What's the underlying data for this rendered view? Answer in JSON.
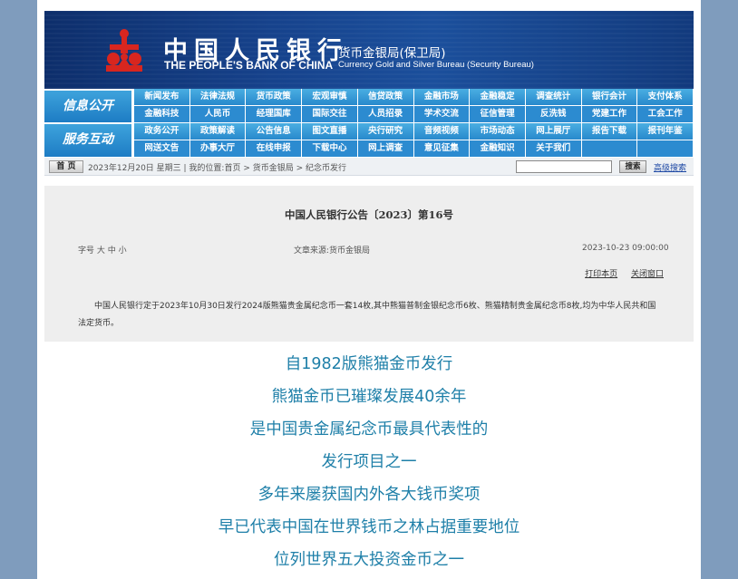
{
  "header": {
    "cn_name": "中国人民银行",
    "en_name": "THE PEOPLE'S BANK OF CHINA",
    "bureau_cn": "货币金银局(保卫局)",
    "bureau_en": "Currency Gold and Silver Bureau (Security Bureau)",
    "logo_icon": "pboc-logo-icon",
    "colors": {
      "banner": "#16428c",
      "logo": "#d8261f",
      "nav": "#2889cc"
    }
  },
  "nav": {
    "label_1": "信息公开",
    "label_2": "服务互动",
    "row1": [
      "新闻发布",
      "法律法规",
      "货币政策",
      "宏观审慎",
      "信贷政策",
      "金融市场",
      "金融稳定",
      "调查统计",
      "银行会计",
      "支付体系"
    ],
    "row2": [
      "金融科技",
      "人民币",
      "经理国库",
      "国际交往",
      "人员招录",
      "学术交流",
      "征信管理",
      "反洗钱",
      "党建工作",
      "工会工作"
    ],
    "row3": [
      "政务公开",
      "政策解读",
      "公告信息",
      "图文直播",
      "央行研究",
      "音频视频",
      "市场动态",
      "网上展厅",
      "报告下载",
      "报刊年鉴"
    ],
    "row4": [
      "网送文告",
      "办事大厅",
      "在线申报",
      "下载中心",
      "网上调查",
      "意见征集",
      "金融知识",
      "关于我们",
      "",
      ""
    ]
  },
  "crumb": {
    "home": "首 页",
    "text": "2023年12月20日  星期三  |  我的位置:首页  >  货币金银局  >  纪念币发行",
    "search_button": "搜索",
    "advanced_search": "高级搜索"
  },
  "article": {
    "title": "中国人民银行公告〔2023〕第16号",
    "font_size": "字号 大 中 小",
    "source": "文章来源:货币金银局",
    "date": "2023-10-23  09:00:00",
    "print": "打印本页",
    "close": "关闭窗口",
    "body": "中国人民银行定于2023年10月30日发行2024版熊猫贵金属纪念币一套14枚,其中熊猫普制金银纪念币6枚、熊猫精制贵金属纪念币8枚,均为中华人民共和国法定货币。"
  },
  "promo": {
    "lines": [
      "自1982版熊猫金币发行",
      "熊猫金币已璀璨发展40余年",
      "是中国贵金属纪念币最具代表性的",
      "发行项目之一",
      "多年来屡获国内外各大钱币奖项",
      "早已代表中国在世界钱币之林占据重要地位",
      "位列世界五大投资金币之一"
    ],
    "color": "#1e7fa8"
  }
}
